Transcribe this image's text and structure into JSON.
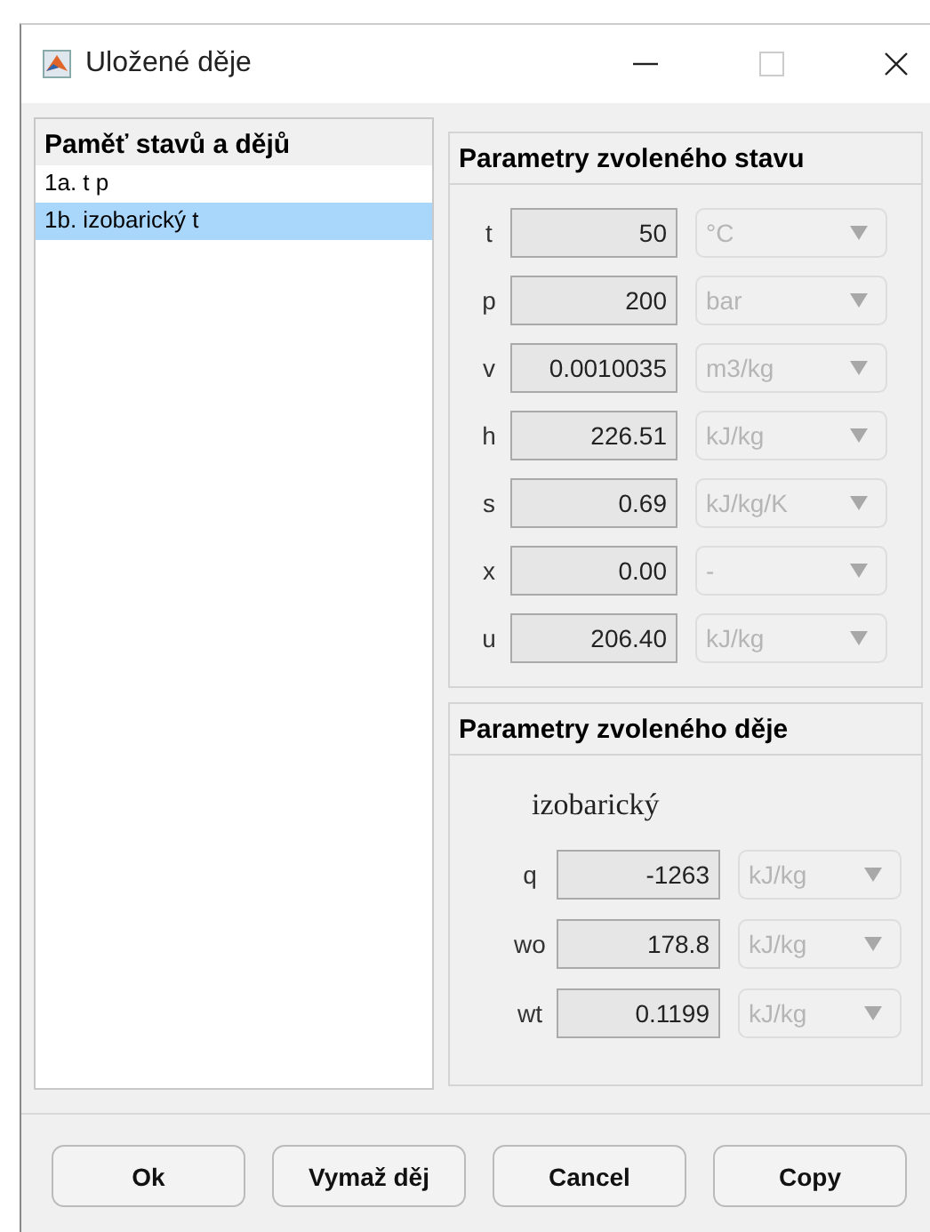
{
  "window": {
    "title": "Uložené děje"
  },
  "memory": {
    "title": "Paměť stavů a dějů",
    "items": [
      {
        "label": "1a. t p",
        "selected": false
      },
      {
        "label": "1b. izobarický t",
        "selected": true
      }
    ]
  },
  "state": {
    "title": "Parametry zvoleného stavu",
    "rows": [
      {
        "label": "t",
        "value": "50",
        "unit": "°C",
        "disabled": true
      },
      {
        "label": "p",
        "value": "200",
        "unit": "bar",
        "disabled": true
      },
      {
        "label": "v",
        "value": "0.0010035",
        "unit": "m3/kg",
        "disabled": true
      },
      {
        "label": "h",
        "value": "226.51",
        "unit": "kJ/kg",
        "disabled": true
      },
      {
        "label": "s",
        "value": "0.69",
        "unit": "kJ/kg/K",
        "disabled": true
      },
      {
        "label": "x",
        "value": "0.00",
        "unit": "-",
        "disabled": true
      },
      {
        "label": "u",
        "value": "206.40",
        "unit": "kJ/kg",
        "disabled": true
      }
    ]
  },
  "process": {
    "title": "Parametry zvoleného děje",
    "name": "izobarický",
    "rows": [
      {
        "label": "q",
        "value": "-1263",
        "unit": "kJ/kg",
        "disabled": true
      },
      {
        "label": "wo",
        "value": "178.8",
        "unit": "kJ/kg",
        "disabled": true
      },
      {
        "label": "wt",
        "value": "0.1199",
        "unit": "kJ/kg",
        "disabled": true
      }
    ]
  },
  "buttons": [
    "Ok",
    "Vymaž děj",
    "Cancel",
    "Copy"
  ]
}
